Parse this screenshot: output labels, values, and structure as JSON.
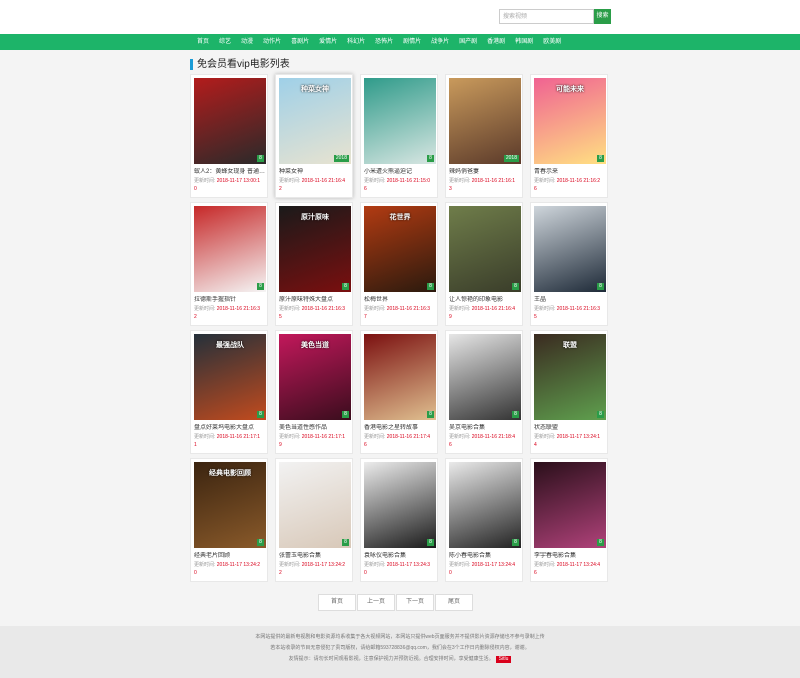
{
  "search": {
    "placeholder": "搜索视频",
    "button_label": "搜索"
  },
  "nav": [
    "首页",
    "综艺",
    "动漫",
    "动作片",
    "喜剧片",
    "爱情片",
    "科幻片",
    "恐怖片",
    "剧情片",
    "战争片",
    "国产剧",
    "香港剧",
    "韩国剧",
    "欧美剧"
  ],
  "section_title": "免会员看vip电影列表",
  "meta_label": "更新时间:",
  "movies": [
    {
      "title": "蚁人2：黄蜂女现身 普通…",
      "time": "2018-11-17 13:00:1",
      "tail": "0",
      "badge": "8"
    },
    {
      "title": "种菜女神",
      "time": "2018-11-16 21:16:4",
      "tail": "2",
      "badge": "2018",
      "poster_text": "种菜女神"
    },
    {
      "title": "小米遭火熊逼迫记",
      "time": "2018-11-16 21:15:0",
      "tail": "6",
      "badge": "8"
    },
    {
      "title": "辣妈俏爸妻",
      "time": "2018-11-16 21:16:1",
      "tail": "3",
      "badge": "2018"
    },
    {
      "title": "青春示来",
      "time": "2018-11-16 21:16:2",
      "tail": "6",
      "badge": "8",
      "poster_text": "可能未来"
    },
    {
      "title": "拉德斯手握指针",
      "time": "2018-11-16 21:16:3",
      "tail": "2",
      "badge": "8"
    },
    {
      "title": "原汁原味特殊大盘点",
      "time": "2018-11-16 21:16:3",
      "tail": "5",
      "badge": "8",
      "poster_text": "原汁原味"
    },
    {
      "title": "松梅世界",
      "time": "2018-11-16 21:16:3",
      "tail": "7",
      "badge": "8",
      "poster_text": "花世界"
    },
    {
      "title": "让人惊艳的印象电影",
      "time": "2018-11-16 21:16:4",
      "tail": "9",
      "badge": "8"
    },
    {
      "title": "王晶",
      "time": "2018-11-16 21:16:3",
      "tail": "5",
      "badge": "8"
    },
    {
      "title": "盘点好莱坞电影大盘点",
      "time": "2018-11-16 21:17:1",
      "tail": "1",
      "badge": "8",
      "poster_text": "最强战队"
    },
    {
      "title": "美色当道性感作品",
      "time": "2018-11-16 21:17:1",
      "tail": "9",
      "badge": "8",
      "poster_text": "美色当道"
    },
    {
      "title": "香港电影之星转故事",
      "time": "2018-11-16 21:17:4",
      "tail": "6",
      "badge": "8"
    },
    {
      "title": "吴京电影合集",
      "time": "2018-11-16 21:18:4",
      "tail": "6",
      "badge": "8"
    },
    {
      "title": "状态联盟",
      "time": "2018-11-17 13:24:1",
      "tail": "4",
      "badge": "8",
      "poster_text": "联盟"
    },
    {
      "title": "经典老片回顾",
      "time": "2018-11-17 13:24:2",
      "tail": "0",
      "badge": "8",
      "poster_text": "经典电影回顾"
    },
    {
      "title": "张蕾玉电影合集",
      "time": "2018-11-17 13:24:2",
      "tail": "2",
      "badge": "8"
    },
    {
      "title": "袁咏仪电影合集",
      "time": "2018-11-17 13:24:3",
      "tail": "0",
      "badge": "8"
    },
    {
      "title": "陈小春电影合集",
      "time": "2018-11-17 13:24:4",
      "tail": "0",
      "badge": "8"
    },
    {
      "title": "李宇春电影合集",
      "time": "2018-11-17 13:24:4",
      "tail": "6",
      "badge": "8"
    }
  ],
  "pagination": [
    "首页",
    "上一页",
    "下一页",
    "尾页"
  ],
  "footer": {
    "line1": "本网站提供的最新电视剧和电影资源均系收集于各大视频网站，本网站只提供web页面服务并不提供影片资源存储也不参与录制上传",
    "line2": "若本站收录的节目无意侵犯了贵司版权，请给邮箱593728836@qq.com，我们会在3个工作日内删除侵权内容，谢谢。",
    "line3": "友情提示：请勿长时间观看影视，注意保护视力并预防近视。合理安排时间，享受健康生活。",
    "tag": "Sitlu"
  }
}
